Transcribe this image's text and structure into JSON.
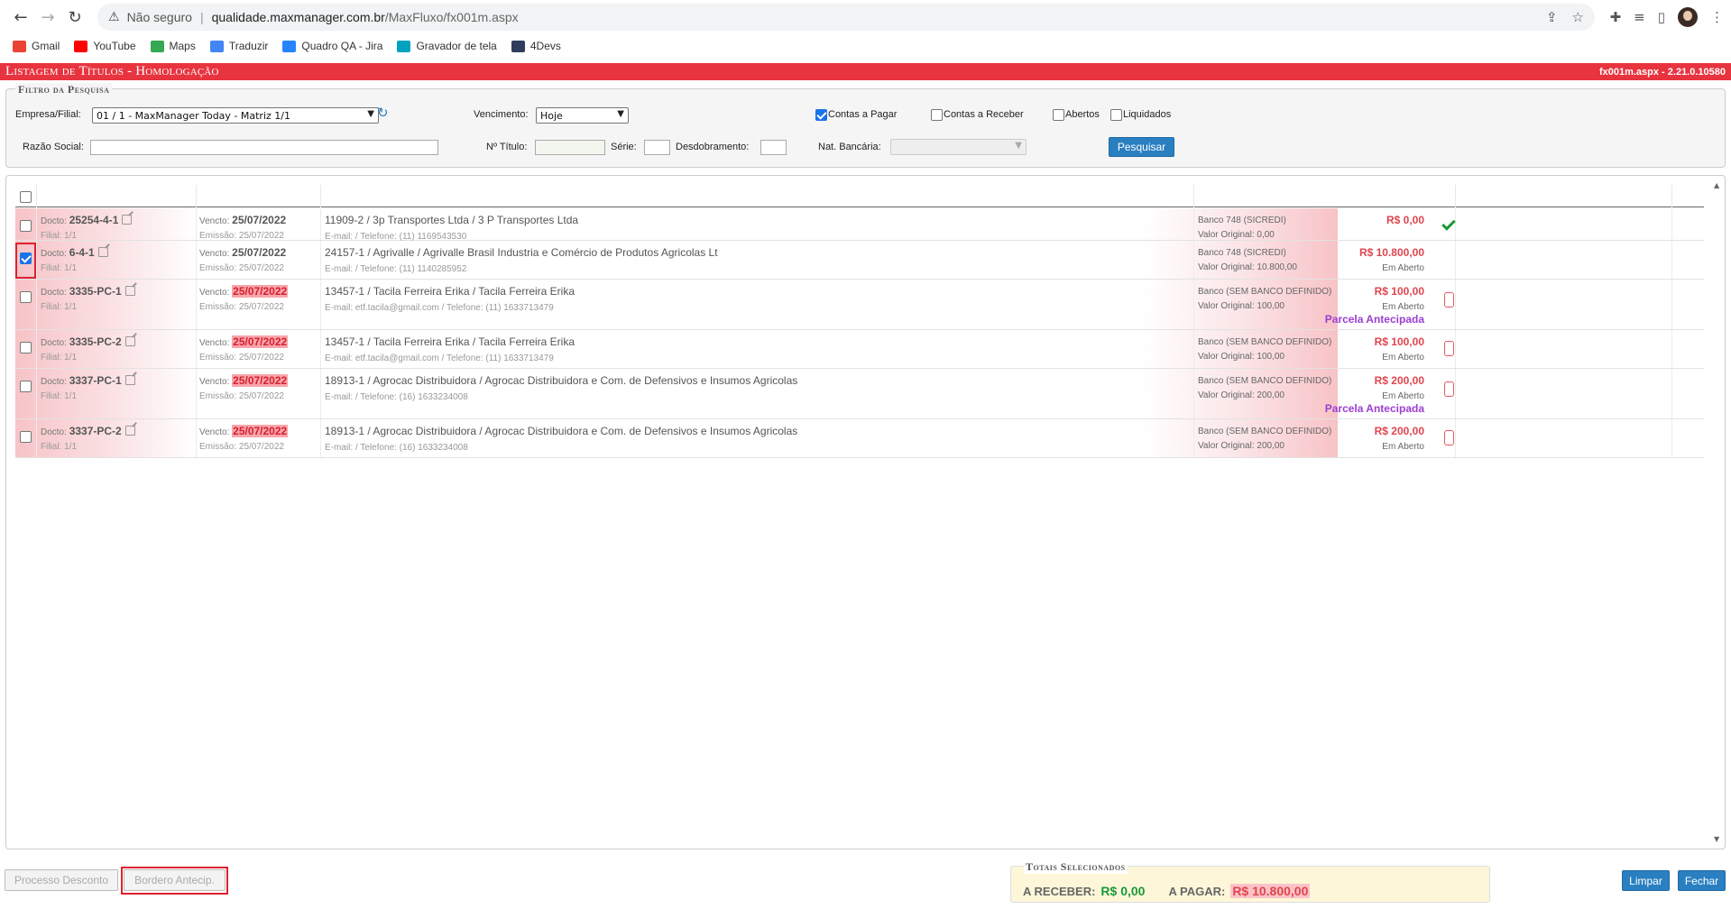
{
  "browser": {
    "security": "Não seguro",
    "url_host": "qualidade.maxmanager.com.br",
    "url_path": "/MaxFluxo/fx001m.aspx",
    "bookmarks": [
      {
        "label": "Gmail",
        "color": "#ea4335"
      },
      {
        "label": "YouTube",
        "color": "#ff0000"
      },
      {
        "label": "Maps",
        "color": "#34a853"
      },
      {
        "label": "Traduzir",
        "color": "#4285f4"
      },
      {
        "label": "Quadro QA - Jira",
        "color": "#2684ff"
      },
      {
        "label": "Gravador de tela",
        "color": "#00a3bf"
      },
      {
        "label": "4Devs",
        "color": "#2f3c5c"
      }
    ]
  },
  "header": {
    "title": "Listagem de Títulos  - Homologação",
    "version": "fx001m.aspx - 2.21.0.10580"
  },
  "filter": {
    "legend": "Filtro da Pesquisa",
    "empresa_label": "Empresa/Filial:",
    "empresa_value": "01 / 1 - MaxManager Today - Matriz 1/1",
    "vencimento_label": "Vencimento:",
    "vencimento_value": "Hoje",
    "contas_pagar": "Contas a Pagar",
    "contas_receber": "Contas a Receber",
    "abertos": "Abertos",
    "liquidados": "Liquidados",
    "razao_label": "Razão Social:",
    "titulo_label": "Nº Título:",
    "serie_label": "Série:",
    "desdobramento_label": "Desdobramento:",
    "nat_label": "Nat. Bancária:",
    "search_button": "Pesquisar"
  },
  "rows": [
    {
      "doc_label": "Docto:",
      "doc": "25254-4-1",
      "filial": "Filial: 1/1",
      "venc_label": "Vencto:",
      "venc": "25/07/2022",
      "venc_red": false,
      "emissao": "Emissão: 25/07/2022",
      "party": "11909-2 / 3p Transportes Ltda / 3 P Transportes Ltda",
      "contact": "E-mail: / Telefone: (11) 1169543530",
      "banco": "Banco 748 (SICREDI)",
      "original": "Valor Original: 0,00",
      "valor": "R$ 0,00",
      "status": "",
      "antecipada": "",
      "icon": "check",
      "checked": false,
      "height": 36
    },
    {
      "doc_label": "Docto:",
      "doc": "6-4-1",
      "filial": "Filial: 1/1",
      "venc_label": "Vencto:",
      "venc": "25/07/2022",
      "venc_red": false,
      "emissao": "Emissão: 25/07/2022",
      "party": "24157-1 / Agrivalle / Agrivalle Brasil Industria e Comércio de Produtos Agricolas Lt",
      "contact": "E-mail: / Telefone: (11) 1140285952",
      "banco": "Banco 748 (SICREDI)",
      "original": "Valor Original: 10.800,00",
      "valor": "R$ 10.800,00",
      "status": "Em Aberto",
      "antecipada": "",
      "icon": "",
      "checked": true,
      "height": 43
    },
    {
      "doc_label": "Docto:",
      "doc": "3335-PC-1",
      "filial": "Filial: 1/1",
      "venc_label": "Vencto:",
      "venc": "25/07/2022",
      "venc_red": true,
      "emissao": "Emissão: 25/07/2022",
      "party": "13457-1 / Tacila Ferreira Erika / Tacila Ferreira Erika",
      "contact": "E-mail: etf.tacila@gmail.com / Telefone: (11) 1633713479",
      "banco": "Banco (SEM BANCO DEFINIDO)",
      "original": "Valor Original: 100,00",
      "valor": "R$ 100,00",
      "status": "Em Aberto",
      "antecipada": "Parcela Antecipada",
      "icon": "trash",
      "checked": false,
      "height": 56
    },
    {
      "doc_label": "Docto:",
      "doc": "3335-PC-2",
      "filial": "Filial: 1/1",
      "venc_label": "Vencto:",
      "venc": "25/07/2022",
      "venc_red": true,
      "emissao": "Emissão: 25/07/2022",
      "party": "13457-1 / Tacila Ferreira Erika / Tacila Ferreira Erika",
      "contact": "E-mail: etf.tacila@gmail.com / Telefone: (11) 1633713479",
      "banco": "Banco (SEM BANCO DEFINIDO)",
      "original": "Valor Original: 100,00",
      "valor": "R$ 100,00",
      "status": "Em Aberto",
      "antecipada": "",
      "icon": "trash",
      "checked": false,
      "height": 43
    },
    {
      "doc_label": "Docto:",
      "doc": "3337-PC-1",
      "filial": "Filial: 1/1",
      "venc_label": "Vencto:",
      "venc": "25/07/2022",
      "venc_red": true,
      "emissao": "Emissão: 25/07/2022",
      "party": "18913-1 / Agrocac Distribuidora / Agrocac Distribuidora e Com. de Defensivos e Insumos Agricolas",
      "contact": "E-mail: / Telefone: (16) 1633234008",
      "banco": "Banco (SEM BANCO DEFINIDO)",
      "original": "Valor Original: 200,00",
      "valor": "R$ 200,00",
      "status": "Em Aberto",
      "antecipada": "Parcela Antecipada",
      "icon": "trash",
      "checked": false,
      "height": 56
    },
    {
      "doc_label": "Docto:",
      "doc": "3337-PC-2",
      "filial": "Filial: 1/1",
      "venc_label": "Vencto:",
      "venc": "25/07/2022",
      "venc_red": true,
      "emissao": "Emissão: 25/07/2022",
      "party": "18913-1 / Agrocac Distribuidora / Agrocac Distribuidora e Com. de Defensivos e Insumos Agricolas",
      "contact": "E-mail: / Telefone: (16) 1633234008",
      "banco": "Banco (SEM BANCO DEFINIDO)",
      "original": "Valor Original: 200,00",
      "valor": "R$ 200,00",
      "status": "Em Aberto",
      "antecipada": "",
      "icon": "trash",
      "checked": false,
      "height": 43
    }
  ],
  "footer": {
    "processo_desconto": "Processo Desconto",
    "bordero": "Bordero Antecip.",
    "totals_legend": "Totais Selecionados",
    "a_receber_label": "A RECEBER:",
    "a_receber": "R$ 0,00",
    "a_pagar_label": "A PAGAR:",
    "a_pagar": "R$ 10.800,00",
    "limpar": "Limpar",
    "fechar": "Fechar"
  }
}
